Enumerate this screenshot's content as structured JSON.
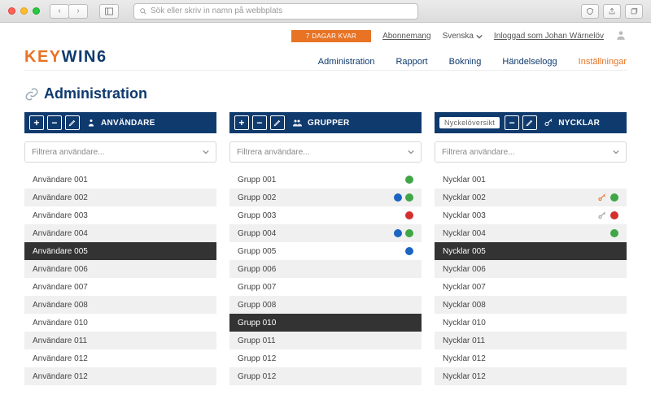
{
  "chrome": {
    "url_placeholder": "Sök eller skriv in namn på webbplats"
  },
  "topbar": {
    "days_left": "7 DAGAR KVAR",
    "subscription": "Abonnemang",
    "language": "Svenska",
    "logged_in_as": "Inloggad som Johan Wärnelöv"
  },
  "logo": {
    "first": "KEY",
    "rest": "WIN6"
  },
  "nav": {
    "items": [
      {
        "label": "Administration",
        "active": false
      },
      {
        "label": "Rapport",
        "active": false
      },
      {
        "label": "Bokning",
        "active": false
      },
      {
        "label": "Händelselogg",
        "active": false
      },
      {
        "label": "Inställningar",
        "active": true
      }
    ]
  },
  "page_title": "Administration",
  "panel_users": {
    "title": "ANVÄNDARE",
    "filter_placeholder": "Filtrera användare...",
    "rows": [
      {
        "label": "Användare 001"
      },
      {
        "label": "Användare 002"
      },
      {
        "label": "Användare 003"
      },
      {
        "label": "Användare 004"
      },
      {
        "label": "Användare 005",
        "selected": true
      },
      {
        "label": "Användare 006"
      },
      {
        "label": "Användare 007"
      },
      {
        "label": "Användare 008"
      },
      {
        "label": "Användare 010"
      },
      {
        "label": "Användare 011"
      },
      {
        "label": "Användare 012"
      },
      {
        "label": "Användare 012"
      }
    ]
  },
  "panel_groups": {
    "title": "GRUPPER",
    "filter_placeholder": "Filtrera användare...",
    "rows": [
      {
        "label": "Grupp 001",
        "status": [
          "green"
        ]
      },
      {
        "label": "Grupp 002",
        "status": [
          "blue",
          "green"
        ]
      },
      {
        "label": "Grupp 003",
        "status": [
          "red"
        ]
      },
      {
        "label": "Grupp 004",
        "status": [
          "blue",
          "green"
        ]
      },
      {
        "label": "Grupp 005",
        "status": [
          "blue"
        ]
      },
      {
        "label": "Grupp 006"
      },
      {
        "label": "Grupp 007"
      },
      {
        "label": "Grupp 008"
      },
      {
        "label": "Grupp 010",
        "selected": true
      },
      {
        "label": "Grupp 011"
      },
      {
        "label": "Grupp 012"
      },
      {
        "label": "Grupp 012"
      }
    ]
  },
  "panel_keys": {
    "title": "NYCKLAR",
    "overview": "Nyckelöversikt",
    "filter_placeholder": "Filtrera användare...",
    "rows": [
      {
        "label": "Nycklar 001"
      },
      {
        "label": "Nycklar 002",
        "icons": [
          "key-orange",
          "green"
        ]
      },
      {
        "label": "Nycklar 003",
        "icons": [
          "key-gray",
          "red"
        ]
      },
      {
        "label": "Nycklar 004",
        "icons": [
          "green"
        ]
      },
      {
        "label": "Nycklar 005",
        "selected": true
      },
      {
        "label": "Nycklar 006"
      },
      {
        "label": "Nycklar 007"
      },
      {
        "label": "Nycklar 008"
      },
      {
        "label": "Nycklar 010"
      },
      {
        "label": "Nycklar 011"
      },
      {
        "label": "Nycklar 012"
      },
      {
        "label": "Nycklar 012"
      }
    ]
  }
}
